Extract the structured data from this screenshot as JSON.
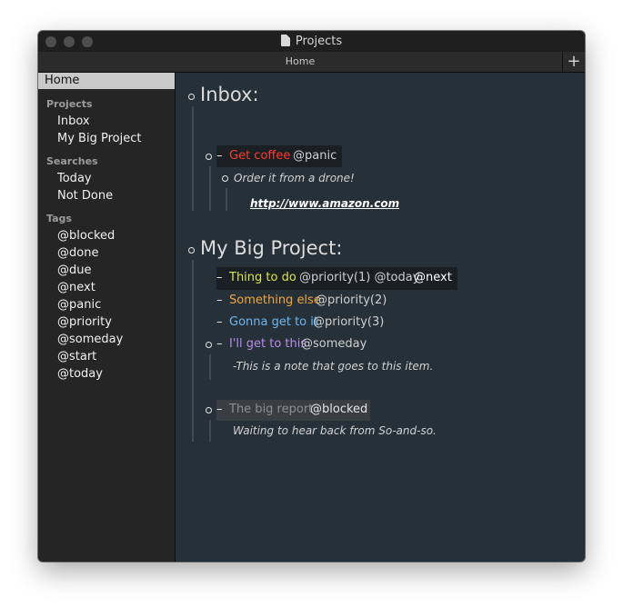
{
  "window": {
    "title": "Projects"
  },
  "tabs": {
    "home": "Home",
    "add": "+"
  },
  "sidebar": {
    "home": "Home",
    "projects_heading": "Projects",
    "projects": [
      "Inbox",
      "My Big Project"
    ],
    "searches_heading": "Searches",
    "searches": [
      "Today",
      "Not Done"
    ],
    "tags_heading": "Tags",
    "tags": [
      "@blocked",
      "@done",
      "@due",
      "@next",
      "@panic",
      "@priority",
      "@someday",
      "@start",
      "@today"
    ]
  },
  "outline": {
    "inbox": {
      "title": "Inbox:",
      "item1": {
        "dash": "–",
        "text": "Get coffee",
        "tag": "@panic"
      },
      "note1": "Order it from a drone!",
      "link1": "http://www.amazon.com"
    },
    "project": {
      "title": "My Big Project:",
      "item1": {
        "dash": "–",
        "text": "Thing to do",
        "tags": "@priority(1) @today",
        "tag2": "@next"
      },
      "item2": {
        "dash": "–",
        "text": "Something else",
        "tags": "@priority(2)"
      },
      "item3": {
        "dash": "–",
        "text": "Gonna get to it",
        "tags": "@priority(3)"
      },
      "item4": {
        "dash": "–",
        "text": "I'll get to this",
        "tags": "@someday"
      },
      "note4": "-This is a note that goes to this item.",
      "item5": {
        "dash": "–",
        "text": "The big report",
        "tags": "@blocked"
      },
      "note5": "Waiting to hear back from So-and-so."
    }
  },
  "colors": {
    "panic": "#ff3b30",
    "priority1": "#d8e64a",
    "priority2": "#f3a53f",
    "priority3": "#6fb6f0",
    "someday": "#b58ee8",
    "blocked": "#8e8e8e"
  }
}
